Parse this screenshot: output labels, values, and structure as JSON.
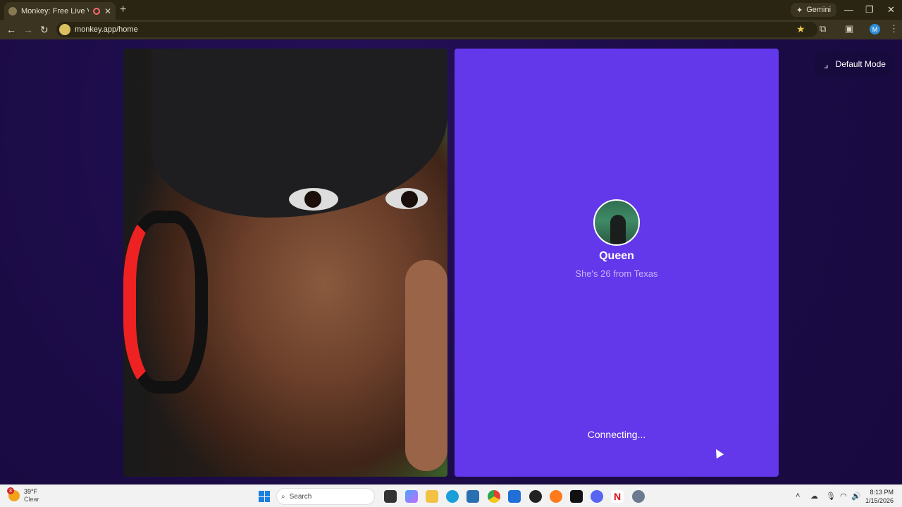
{
  "browser": {
    "tab_title": "Monkey: Free Live Video Ch",
    "tab_close": "✕",
    "new_tab": "+",
    "gemini_label": "Gemini",
    "url": "monkey.app/home",
    "window_controls": [
      "—",
      "❐",
      "✕"
    ]
  },
  "page": {
    "mode_button_label": "Default Mode",
    "peer": {
      "name": "Queen",
      "info": "She's 26 from Texas",
      "status": "Connecting..."
    }
  },
  "taskbar": {
    "weather_temp": "39°F",
    "weather_cond": "Clear",
    "weather_badge": "3",
    "search_label": "Search",
    "time": "8:13 PM",
    "date": "1/15/2026"
  },
  "colors": {
    "peer_panel": "#6337ea",
    "page_bg": "#1c0b4a",
    "chrome_bg": "#3a3420"
  }
}
